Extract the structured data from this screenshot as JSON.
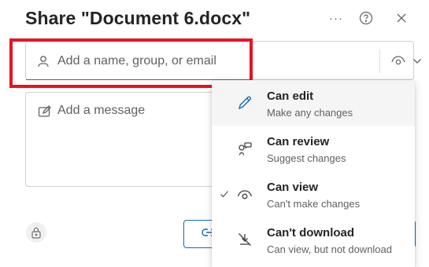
{
  "header": {
    "title": "Share \"Document 6.docx\"",
    "more_icon": "more-horizontal-icon",
    "help_icon": "question-circle-icon",
    "close_icon": "close-icon"
  },
  "recipient": {
    "placeholder": "Add a name, group, or email",
    "value": "",
    "icon": "person-icon",
    "permission_icon": "eye-icon"
  },
  "message": {
    "placeholder": "Add a message",
    "value": "",
    "icon": "edit-note-icon"
  },
  "footer": {
    "lock_icon": "lock-icon",
    "link_icon": "link-icon"
  },
  "permission_menu": {
    "items": [
      {
        "label": "Can edit",
        "description": "Make any changes",
        "icon": "pencil-icon",
        "selected": false,
        "hovered": true
      },
      {
        "label": "Can review",
        "description": "Suggest changes",
        "icon": "review-icon",
        "selected": false,
        "hovered": false
      },
      {
        "label": "Can view",
        "description": "Can't make changes",
        "icon": "eye-icon",
        "selected": true,
        "hovered": false
      },
      {
        "label": "Can't download",
        "description": "Can view, but not download",
        "icon": "no-download-icon",
        "selected": false,
        "hovered": false
      }
    ]
  },
  "colors": {
    "highlight": "#e81224",
    "accent": "#0f6cbd"
  }
}
